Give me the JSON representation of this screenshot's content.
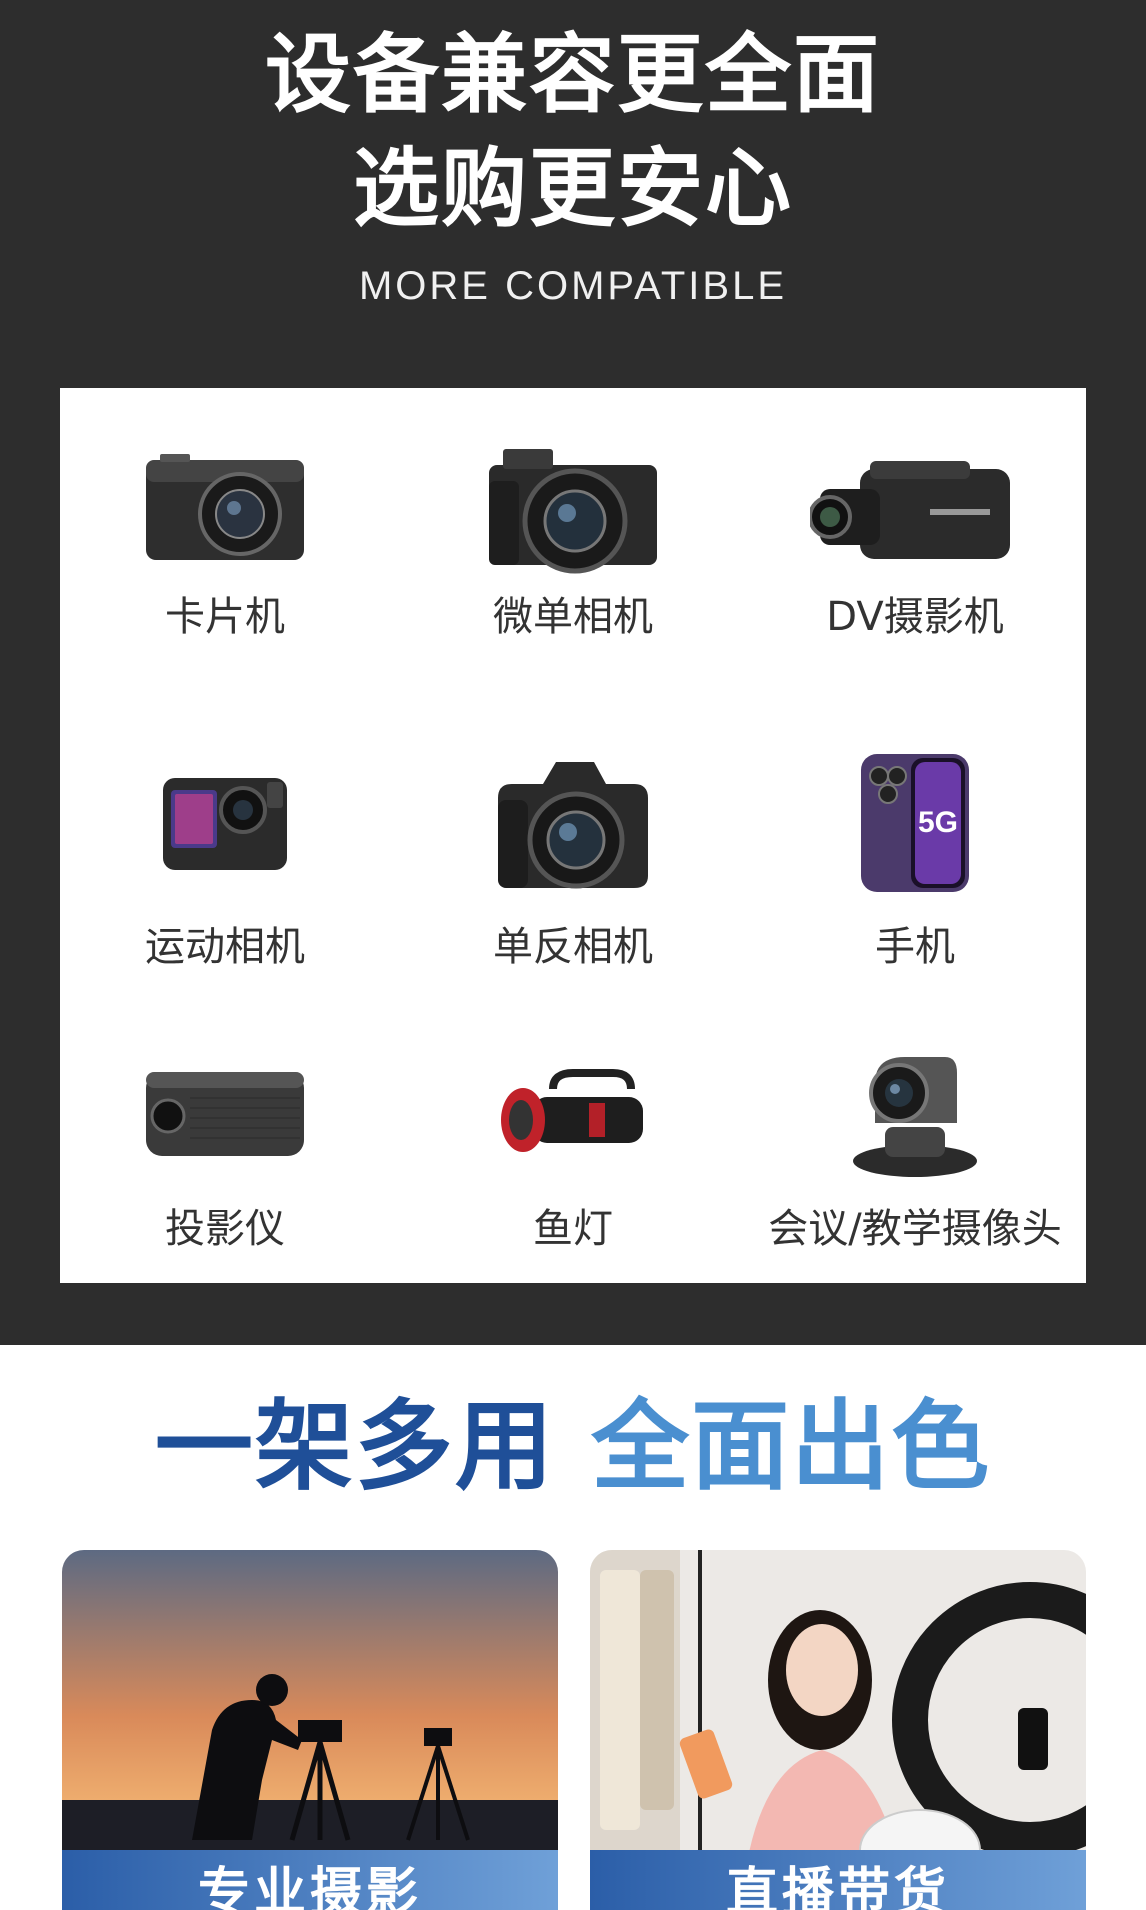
{
  "header": {
    "line1": "设备兼容更全面",
    "line2": "选购更安心",
    "subtitle": "MORE COMPATIBLE"
  },
  "devices": [
    {
      "label": "卡片机",
      "icon": "compact-camera-icon"
    },
    {
      "label": "微单相机",
      "icon": "mirrorless-camera-icon"
    },
    {
      "label": "DV摄影机",
      "icon": "camcorder-icon"
    },
    {
      "label": "运动相机",
      "icon": "action-camera-icon"
    },
    {
      "label": "单反相机",
      "icon": "dslr-camera-icon"
    },
    {
      "label": "手机",
      "icon": "phone-icon"
    },
    {
      "label": "投影仪",
      "icon": "projector-icon"
    },
    {
      "label": "鱼灯",
      "icon": "fish-light-icon"
    },
    {
      "label": "会议/教学摄像头",
      "icon": "conference-camera-icon"
    }
  ],
  "phone_badge": "5G",
  "section2": {
    "title_part1": "一架多用",
    "title_part2": "全面出色"
  },
  "scenes": [
    {
      "label": "专业摄影"
    },
    {
      "label": "直播带货"
    }
  ],
  "colors": {
    "dark_bg": "#2d2d2d",
    "title_blue_dark": "#1f4f98",
    "title_blue_light": "#4a8fd0"
  }
}
